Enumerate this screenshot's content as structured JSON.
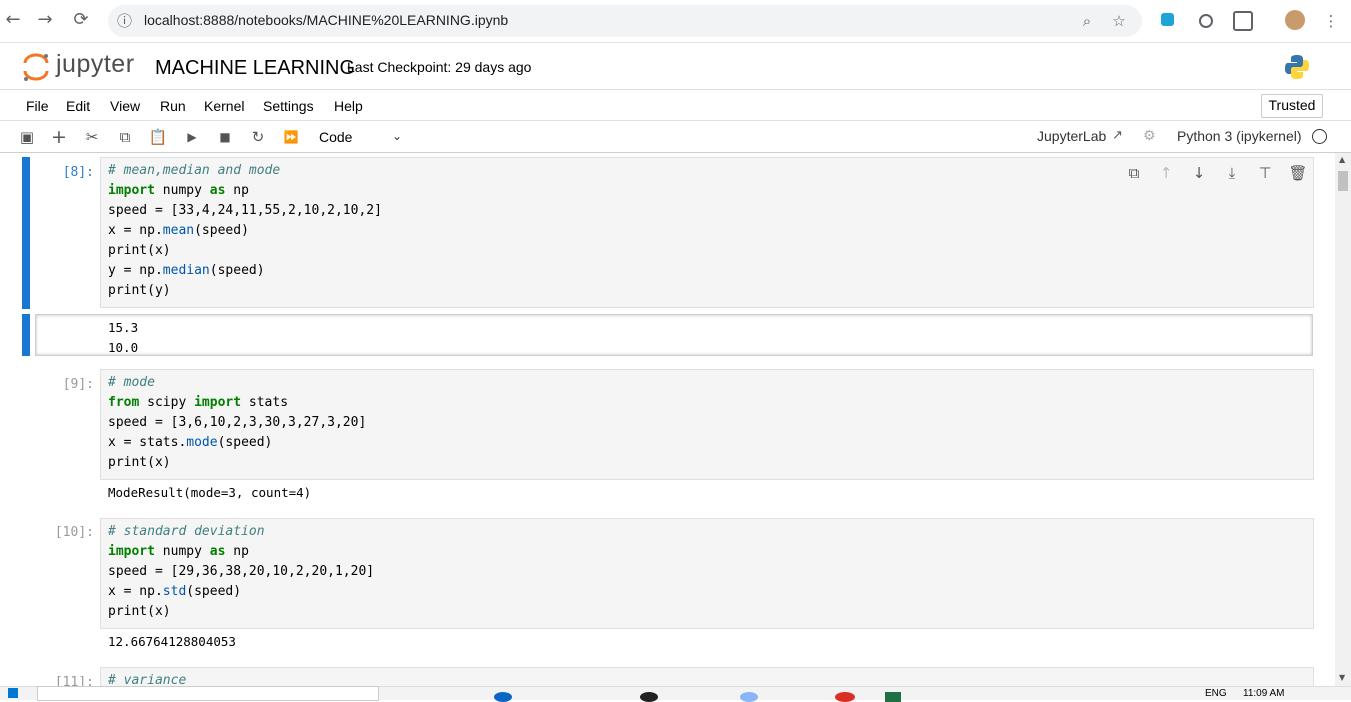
{
  "browser": {
    "back_icon": "←",
    "forward_icon": "→",
    "reload_icon": "⟳",
    "info_icon": "ⓘ",
    "url": "localhost:8888/notebooks/MACHINE%20LEARNING.ipynb",
    "zoom_icon": "⌕",
    "star_icon": "☆",
    "menu_icon": "⋮"
  },
  "header": {
    "logo_text": "jupyter",
    "notebook_title": "MACHINE LEARNING",
    "checkpoint": "Last Checkpoint: 29 days ago"
  },
  "menu": {
    "items": [
      "File",
      "Edit",
      "View",
      "Run",
      "Kernel",
      "Settings",
      "Help"
    ],
    "trusted": "Trusted"
  },
  "toolbar": {
    "cell_type": "Code",
    "jupyterlab_label": "JupyterLab",
    "kernel_name": "Python 3 (ipykernel)"
  },
  "cells": [
    {
      "prompt": "[8]:",
      "output": "15.3\n10.0"
    },
    {
      "prompt": "[9]:",
      "output": "ModeResult(mode=3, count=4)"
    },
    {
      "prompt": "[10]:",
      "output": "12.66764128804053"
    },
    {
      "prompt": "[11]:",
      "first_line": "# variance"
    }
  ],
  "code": {
    "c8": [
      "# mean,median and mode",
      "import",
      " numpy ",
      "as",
      " np",
      "speed = [33,4,24,11,55,2,10,2,10,2]",
      "x = np.",
      "mean",
      "(speed)",
      "print(x)",
      "y = np.",
      "median",
      "(speed)",
      "print(y)"
    ],
    "c9": [
      "# mode",
      "from",
      " scipy ",
      "import",
      " stats",
      "speed = [3,6,10,2,3,30,3,27,3,20]",
      "x = stats.",
      "mode",
      "(speed)",
      "print(x)"
    ],
    "c10": [
      "# standard deviation",
      "import",
      " numpy ",
      "as",
      " np",
      "speed = [29,36,38,20,10,2,20,1,20]",
      "x = np.",
      "std",
      "(speed)",
      "print(x)"
    ]
  },
  "taskbar": {
    "language": "ENG",
    "time": "11:09 AM"
  },
  "colors": {
    "accent": "#1976d2",
    "comment": "#408080",
    "keyword": "#008000"
  }
}
